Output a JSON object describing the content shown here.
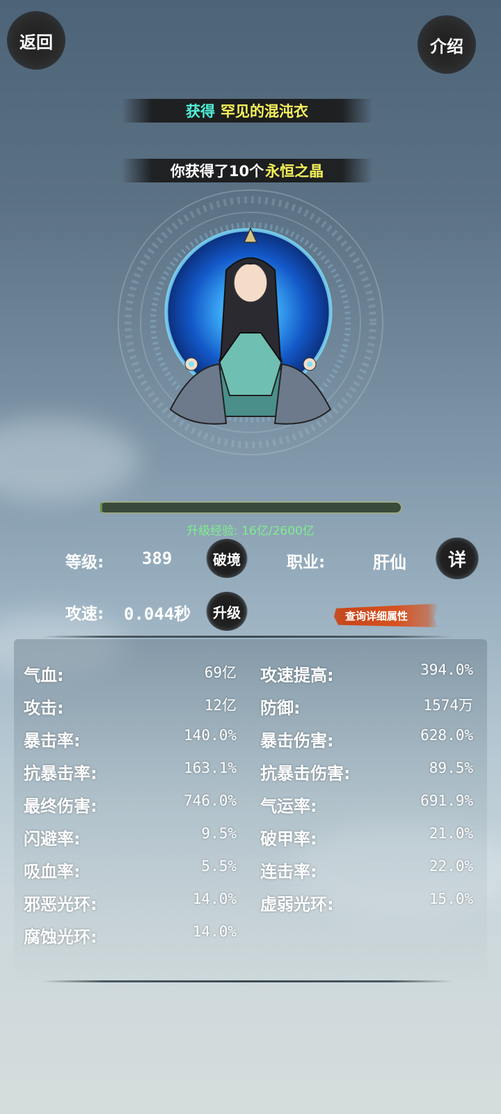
{
  "header": {
    "back_label": "返回",
    "intro_label": "介绍"
  },
  "banners": {
    "obtain_prefix": "获得",
    "obtain_item": "罕见的混沌衣",
    "reward_prefix": "你获得了10个",
    "reward_item": "永恒之晶"
  },
  "xp": {
    "label": "升级经验: 16亿/2600亿",
    "progress_fraction": 0.006
  },
  "profile": {
    "level_label": "等级:",
    "level_value": "389",
    "breakthrough_label": "破境",
    "class_label": "职业:",
    "class_value": "肝仙",
    "detail_label": "详",
    "speed_label": "攻速:",
    "speed_value": "0.044秒",
    "upgrade_label": "升级",
    "query_label": "查询详细属性"
  },
  "attributes": {
    "left": [
      {
        "name": "气血:",
        "value": "69亿"
      },
      {
        "name": "攻击:",
        "value": "12亿"
      },
      {
        "name": "暴击率:",
        "value": "140.0%"
      },
      {
        "name": "抗暴击率:",
        "value": "163.1%"
      },
      {
        "name": "最终伤害:",
        "value": "746.0%"
      },
      {
        "name": "闪避率:",
        "value": "9.5%"
      },
      {
        "name": "吸血率:",
        "value": "5.5%"
      },
      {
        "name": "邪恶光环:",
        "value": "14.0%"
      },
      {
        "name": "腐蚀光环:",
        "value": "14.0%"
      }
    ],
    "right": [
      {
        "name": "攻速提高:",
        "value": "394.0%"
      },
      {
        "name": "防御:",
        "value": "1574万"
      },
      {
        "name": "暴击伤害:",
        "value": "628.0%"
      },
      {
        "name": "抗暴击伤害:",
        "value": "89.5%"
      },
      {
        "name": "气运率:",
        "value": "691.9%"
      },
      {
        "name": "破甲率:",
        "value": "21.0%"
      },
      {
        "name": "连击率:",
        "value": "22.0%"
      },
      {
        "name": "虚弱光环:",
        "value": "15.0%"
      }
    ]
  },
  "colors": {
    "obtain_prefix": "#4ff0d6",
    "highlight": "#f4f05a",
    "xp_text": "#7df08c",
    "query_button": "#d6521f"
  }
}
